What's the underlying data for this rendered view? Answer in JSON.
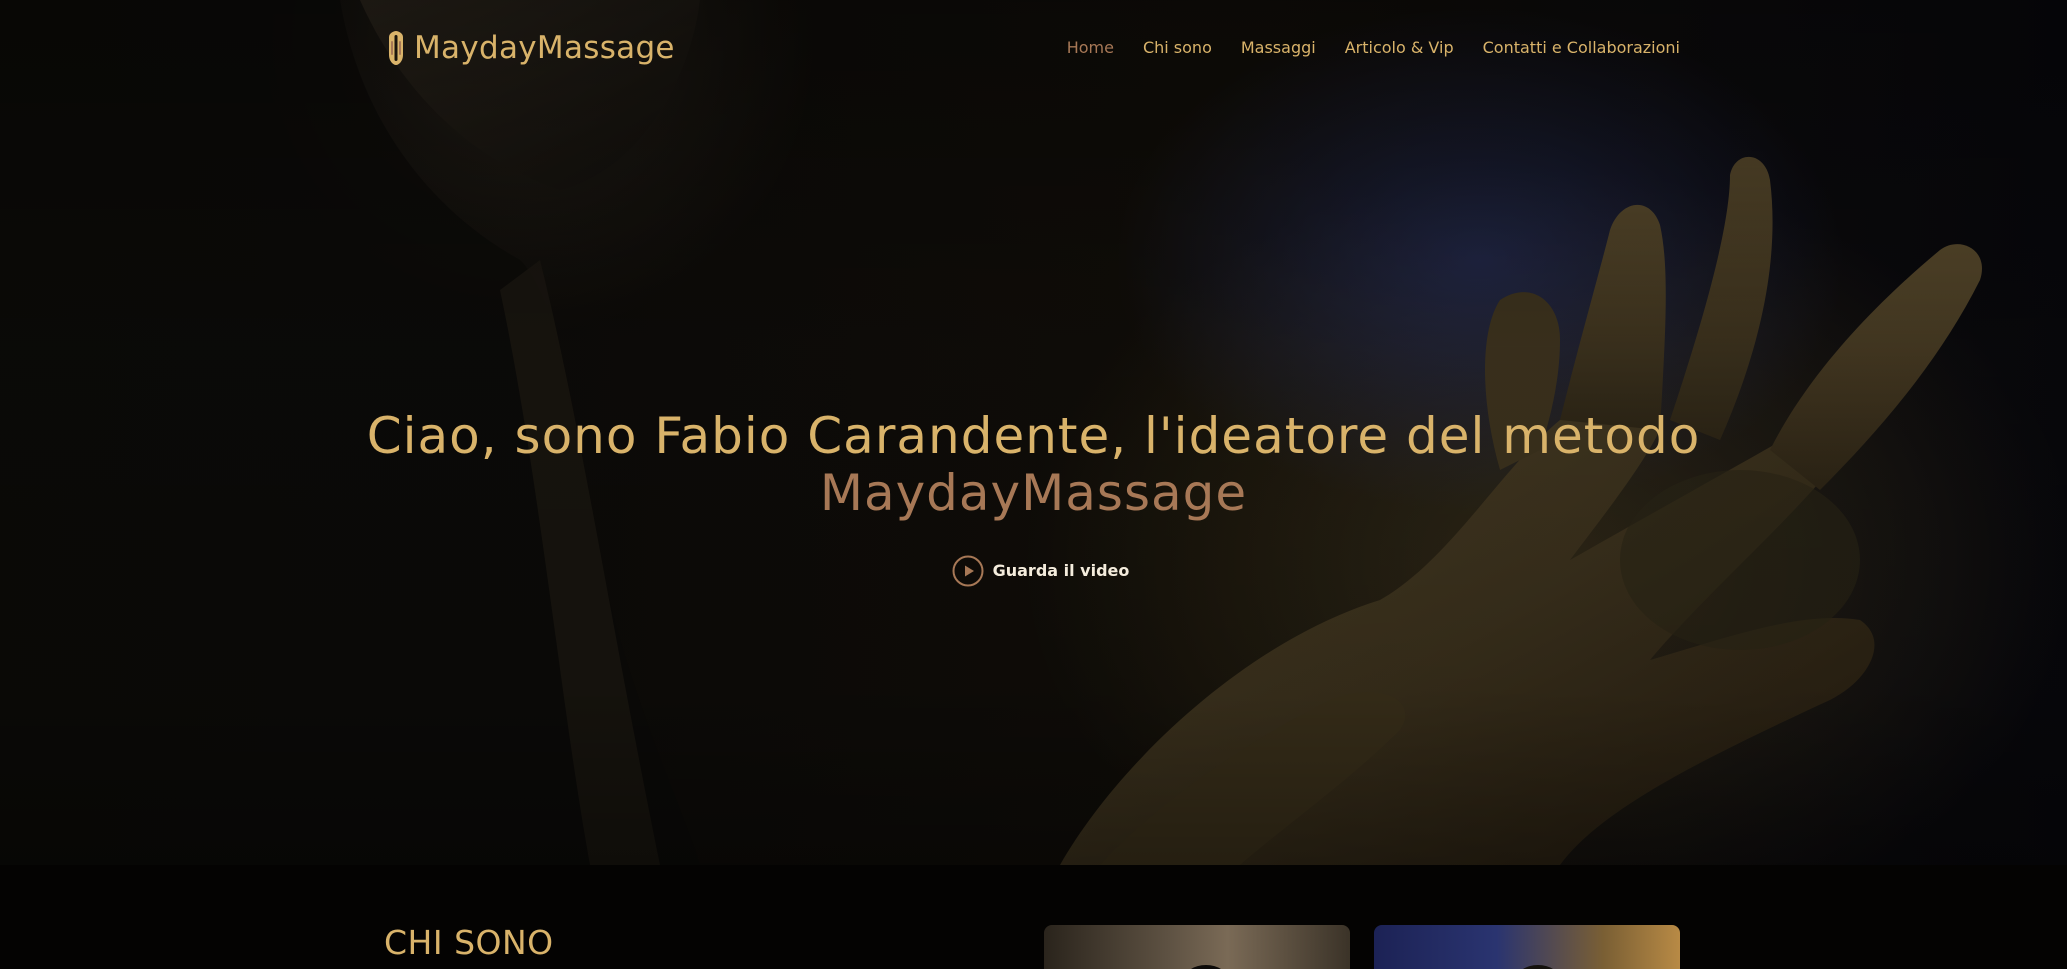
{
  "header": {
    "logo_text": "MaydayMassage",
    "logo_icon": "massage-stone-icon",
    "nav": [
      {
        "label": "Home",
        "active": true
      },
      {
        "label": "Chi sono",
        "active": false
      },
      {
        "label": "Massaggi",
        "active": false
      },
      {
        "label": "Articolo & Vip",
        "active": false
      },
      {
        "label": "Contatti e Collaborazioni",
        "active": false
      }
    ]
  },
  "hero": {
    "title_line1": "Ciao, sono Fabio Carandente, l'ideatore del metodo",
    "title_line2": "MaydayMassage",
    "video_label": "Guarda il video",
    "video_icon": "play-circle-icon"
  },
  "about": {
    "title": "CHI SONO"
  },
  "colors": {
    "gold": "#d9b36a",
    "copper": "#a77856",
    "background": "#050403",
    "white": "#f4ecdc"
  }
}
